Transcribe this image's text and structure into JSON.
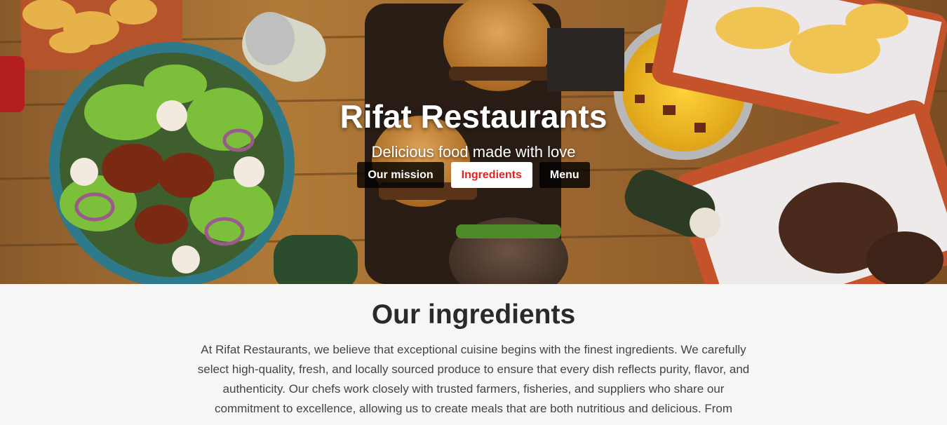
{
  "hero": {
    "title": "Rifat Restaurants",
    "subtitle": "Delicious food made with love",
    "background": "food-table-photo",
    "nav": [
      {
        "label": "Our mission",
        "active": false
      },
      {
        "label": "Ingredients",
        "active": true
      },
      {
        "label": "Menu",
        "active": false
      }
    ]
  },
  "ingredients": {
    "title": "Our ingredients",
    "text": "At Rifat Restaurants, we believe that exceptional cuisine begins with the finest ingredients. We carefully select high-quality, fresh, and locally sourced produce to ensure that every dish reflects purity, flavor, and authenticity. Our chefs work closely with trusted farmers, fisheries, and suppliers who share our commitment to excellence, allowing us to create meals that are both nutritious and delicious. From"
  },
  "colors": {
    "active_nav_text": "#e02424",
    "nav_bg": "#000000",
    "page_bg": "#f6f6f6",
    "heading": "#2a2a2a"
  }
}
